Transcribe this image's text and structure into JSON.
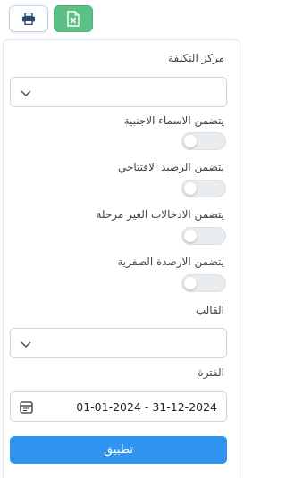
{
  "toolbar": {
    "print_icon": "printer-icon",
    "excel_icon": "excel-file-icon",
    "excel_color": "#5cbf85"
  },
  "form": {
    "cost_center_label": "مركز التكلفة",
    "cost_center_value": "",
    "toggles": [
      {
        "label": "يتضمن الاسماء الاجنبية",
        "checked": false
      },
      {
        "label": "يتضمن الرصيد الافتتاحي",
        "checked": false
      },
      {
        "label": "يتضمن الادخالات الغير مرحلة",
        "checked": false
      },
      {
        "label": "يتضمن الارصدة الصفرية",
        "checked": false
      }
    ],
    "template_label": "القالب",
    "template_value": "",
    "period_label": "الفترة",
    "period_value": "01-01-2024 - 31-12-2024",
    "apply_label": "تطبيق",
    "accent_color": "#2f95f0"
  }
}
